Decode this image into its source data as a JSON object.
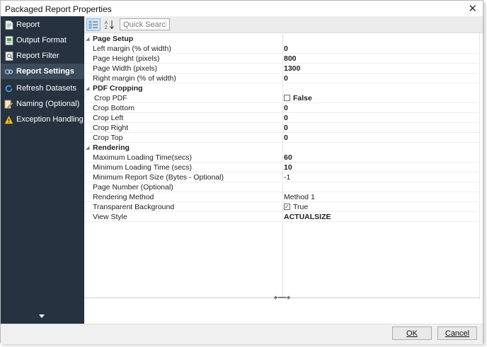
{
  "window": {
    "title": "Packaged Report Properties",
    "close_glyph": "✕"
  },
  "sidebar": {
    "items": [
      {
        "label": "Report",
        "icon": "report-icon",
        "active": false
      },
      {
        "label": "Output Format",
        "icon": "output-format-icon",
        "active": false
      },
      {
        "label": "Report Filter",
        "icon": "report-filter-icon",
        "active": false
      },
      {
        "label": "Report Settings",
        "icon": "report-settings-icon",
        "active": true
      },
      {
        "label": "Refresh Datasets",
        "icon": "refresh-icon",
        "active": false
      },
      {
        "label": "Naming (Optional)",
        "icon": "naming-icon",
        "active": false
      },
      {
        "label": "Exception Handling",
        "icon": "warning-icon",
        "active": false
      }
    ],
    "scroll_down": "chevron-down-icon",
    "background_color": "#26323f",
    "active_color": "#3c4a59"
  },
  "toolbar": {
    "categorized_icon": "categorized-view-icon",
    "alphabetical_icon": "sort-alphabetical-icon",
    "search_placeholder": "Quick Search",
    "search_value": ""
  },
  "property_grid": {
    "page_setup": {
      "title": "Page Setup",
      "left_margin": {
        "label": "Left margin (% of width)",
        "value": "0"
      },
      "page_height": {
        "label": "Page Height (pixels)",
        "value": "800"
      },
      "page_width": {
        "label": "Page Width (pixels)",
        "value": "1300"
      },
      "right_margin": {
        "label": "Right margin (% of width)",
        "value": "0"
      }
    },
    "pdf_cropping": {
      "title": "PDF Cropping",
      "crop_pdf": {
        "label": "Crop PDF",
        "value": "False",
        "checked": false
      },
      "crop_bottom": {
        "label": "Crop Bottom",
        "value": "0"
      },
      "crop_left": {
        "label": "Crop Left",
        "value": "0"
      },
      "crop_right": {
        "label": "Crop Right",
        "value": "0"
      },
      "crop_top": {
        "label": "Crop Top",
        "value": "0"
      }
    },
    "rendering": {
      "title": "Rendering",
      "max_loading": {
        "label": "Maximum Loading Time(secs)",
        "value": "60"
      },
      "min_loading": {
        "label": "Minimum Loading Time (secs)",
        "value": "10"
      },
      "min_report_size": {
        "label": "Minimum Report Size (Bytes - Optional)",
        "value": "-1"
      },
      "page_number": {
        "label": "Page Number (Optional)",
        "value": ""
      },
      "rendering_method": {
        "label": "Rendering Method",
        "value": "Method 1"
      },
      "transparent_bg": {
        "label": "Transparent Background",
        "value": "True",
        "checked": true
      },
      "view_style": {
        "label": "View Style",
        "value": "ACTUALSIZE"
      }
    },
    "collapse_glyph": "◢"
  },
  "footer": {
    "ok_label": "OK",
    "cancel_label": "Cancel"
  }
}
